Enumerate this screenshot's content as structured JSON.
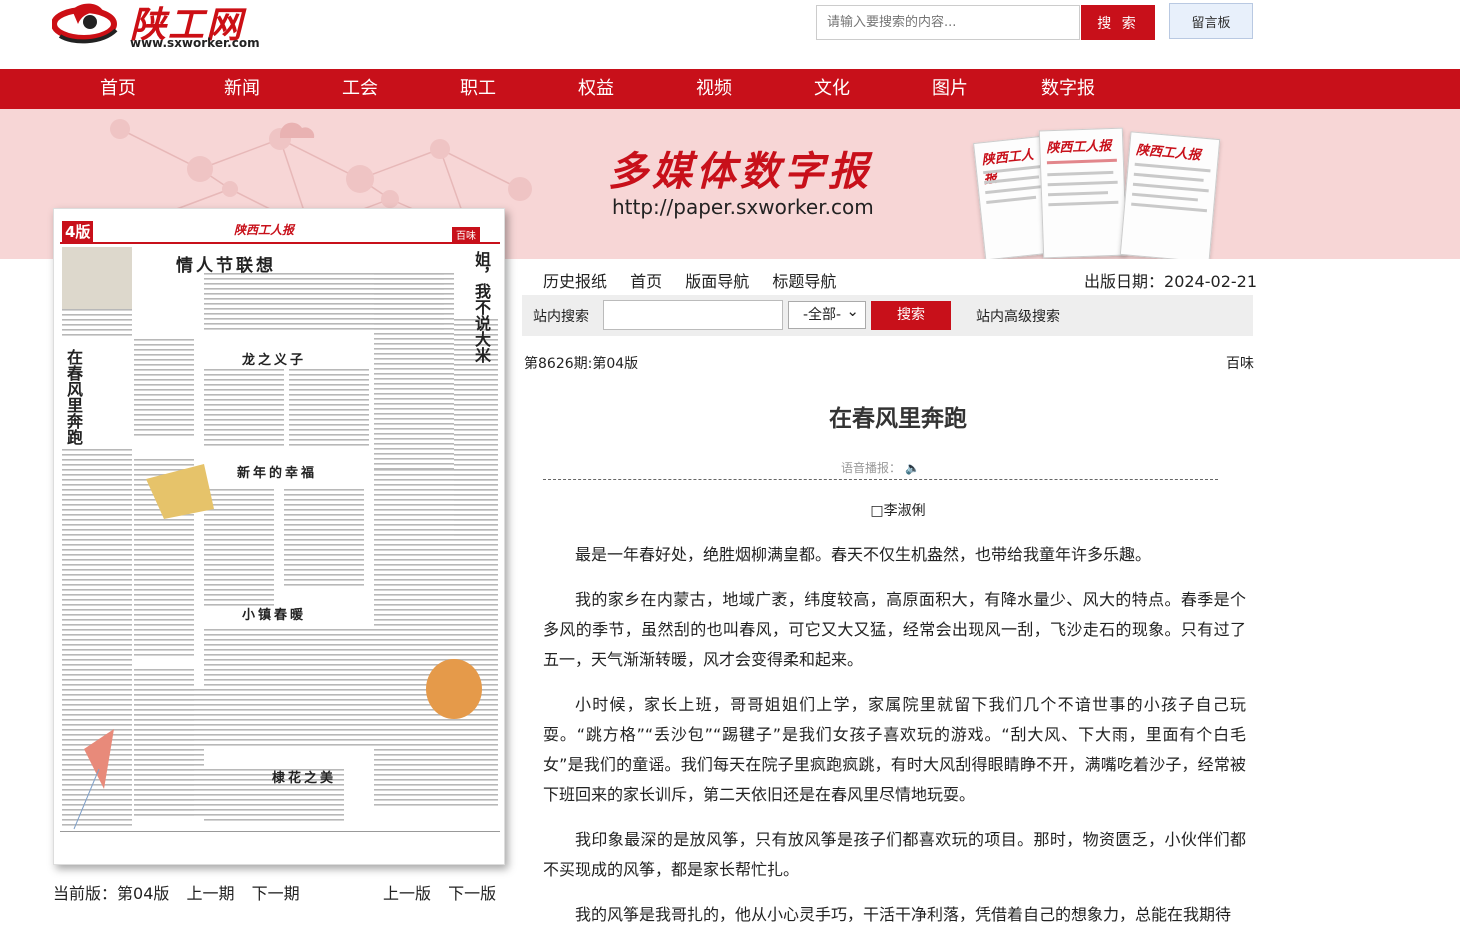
{
  "header": {
    "logo_text": "陕工网",
    "logo_url": "www.sxworker.com",
    "search_placeholder": "请输入要搜索的内容...",
    "search_label": "搜 索",
    "guestbook_label": "留言板"
  },
  "nav": [
    "首页",
    "新闻",
    "工会",
    "职工",
    "权益",
    "视频",
    "文化",
    "图片",
    "数字报"
  ],
  "banner": {
    "title": "多媒体数字报",
    "url": "http://paper.sxworker.com",
    "paper_masthead": "陕西工人报"
  },
  "thumbnail": {
    "page_badge": "4版",
    "masthead": "陕西工人报",
    "section": "百味",
    "headlines": [
      "情人节联想",
      "姐，我不说大米",
      "在春风里奔跑",
      "龙之义子",
      "新年的幸福",
      "小镇春暖",
      "棣花之美"
    ]
  },
  "pager": {
    "current_label": "当前版：",
    "current_value": "第04版",
    "prev_issue": "上一期",
    "next_issue": "下一期",
    "prev_page": "上一版",
    "next_page": "下一版"
  },
  "toolbar": {
    "items": [
      "历史报纸",
      "首页",
      "版面导航",
      "标题导航"
    ],
    "date_label": "出版日期：",
    "date_value": "2024-02-21"
  },
  "site_search": {
    "label": "站内搜索",
    "select_value": "-全部-",
    "button": "搜索",
    "advanced": "站内高级搜索"
  },
  "article": {
    "issue": "第8626期:第04版",
    "column": "百味",
    "title": "在春风里奔跑",
    "voice_label": "语音播报：",
    "author": "□李淑俐",
    "paragraphs": [
      "最是一年春好处，绝胜烟柳满皇都。春天不仅生机盎然，也带给我童年许多乐趣。",
      "我的家乡在内蒙古，地域广袤，纬度较高，高原面积大，有降水量少、风大的特点。春季是个多风的季节，虽然刮的也叫春风，可它又大又猛，经常会出现风一刮，飞沙走石的现象。只有过了五一，天气渐渐转暖，风才会变得柔和起来。",
      "小时候，家长上班，哥哥姐姐们上学，家属院里就留下我们几个不谙世事的小孩子自己玩耍。“跳方格”“丢沙包”“踢毽子”是我们女孩子喜欢玩的游戏。“刮大风、下大雨，里面有个白毛女”是我们的童谣。我们每天在院子里疯跑疯跳，有时大风刮得眼睛睁不开，满嘴吃着沙子，经常被下班回来的家长训斥，第二天依旧还是在春风里尽情地玩耍。",
      "我印象最深的是放风筝，只有放风筝是孩子们都喜欢玩的项目。那时，物资匮乏，小伙伴们都不买现成的风筝，都是家长帮忙扎。",
      "我的风筝是我哥扎的，他从小心灵手巧，干活干净利落，凭借着自己的想象力，总能在我期待"
    ]
  },
  "colors": {
    "brand_red": "#c8101a",
    "banner_bg": "#f7d6d6",
    "searchbar_bg": "#eeeeee"
  }
}
